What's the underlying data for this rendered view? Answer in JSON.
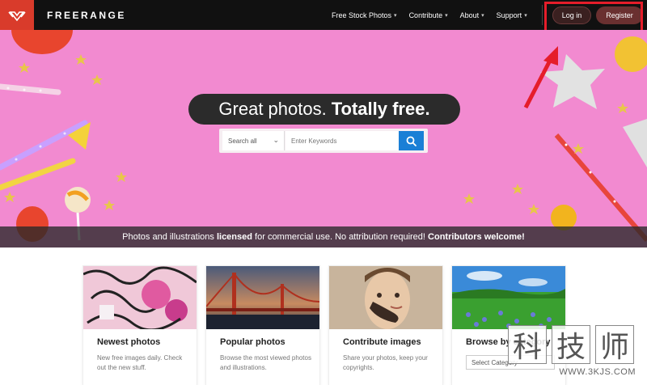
{
  "brand": {
    "name": "FREERANGE",
    "logo_icon": "freerange-logo-icon"
  },
  "nav": {
    "items": [
      {
        "label": "Free Stock Photos"
      },
      {
        "label": "Contribute"
      },
      {
        "label": "About"
      },
      {
        "label": "Support"
      }
    ],
    "login_label": "Log in",
    "register_label": "Register"
  },
  "hero": {
    "tagline_light": "Great photos.",
    "tagline_bold": "Totally free.",
    "search": {
      "category_selected": "Search all",
      "placeholder": "Enter Keywords",
      "button_icon": "search-icon"
    },
    "strip": {
      "part1": "Photos and illustrations ",
      "bold1": "licensed",
      "part2": " for commercial use. No attribution required! ",
      "bold2": "Contributors welcome!"
    }
  },
  "cards": [
    {
      "title": "Newest photos",
      "desc": "New free images daily. Check out the new stuff."
    },
    {
      "title": "Popular photos",
      "desc": "Browse the most viewed photos and illustrations."
    },
    {
      "title": "Contribute images",
      "desc": "Share your photos, keep your copyrights."
    },
    {
      "title": "Browse by category",
      "select_placeholder": "Select Category"
    }
  ],
  "watermark": {
    "chars": [
      "科",
      "技",
      "师"
    ],
    "url": "WWW.3KJS.COM"
  },
  "colors": {
    "navbar": "#111111",
    "logo_bg": "#d93b2b",
    "hero_pink": "#f28ad0",
    "search_button": "#1a7fd6",
    "highlight": "#e51d2a"
  }
}
